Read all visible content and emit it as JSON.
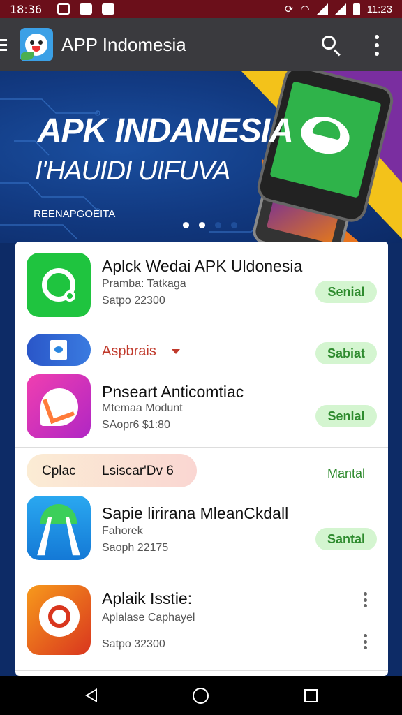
{
  "status_bar": {
    "time": "18:36",
    "right_time": "11:23"
  },
  "app_bar": {
    "title": "APP Indomesia"
  },
  "banner": {
    "title": "APK INDANESIA",
    "subtitle": "I'HAUIDI UIFUVA",
    "small_text": "REENAPGOEITA",
    "active_dot": 2
  },
  "list": {
    "rows": [
      {
        "name": "Aplck Wedai APK Uldonesia",
        "line1": "Pramba: Tatkaga",
        "line2": "Satpo 22300",
        "button": "Senial"
      },
      {
        "category_label": "Aspbrais",
        "button": "Sabiat"
      },
      {
        "name": "Pnseart Anticomtiac",
        "line1": "Mtemaa Modunt",
        "line2": "SAopr6 $1:80",
        "button": "Senlal"
      },
      {
        "pill_left": "Cplac",
        "pill_right": "Lsiscar'Dv 6",
        "button": "Mantal"
      },
      {
        "name": "Sapie lirirana MleanCkdall",
        "line1": "Fahorek",
        "line2": "Saoph 22175",
        "button": "Santal"
      },
      {
        "name": "Aplaik Isstie:",
        "line1": "Aplalase Caphayel",
        "line2": "Satpo 32300"
      }
    ]
  },
  "colors": {
    "status_bar": "#6b0f1a",
    "app_bar": "#3a3a3e",
    "install_button_bg": "#d4f5d0",
    "install_button_text": "#2e8b2e"
  }
}
